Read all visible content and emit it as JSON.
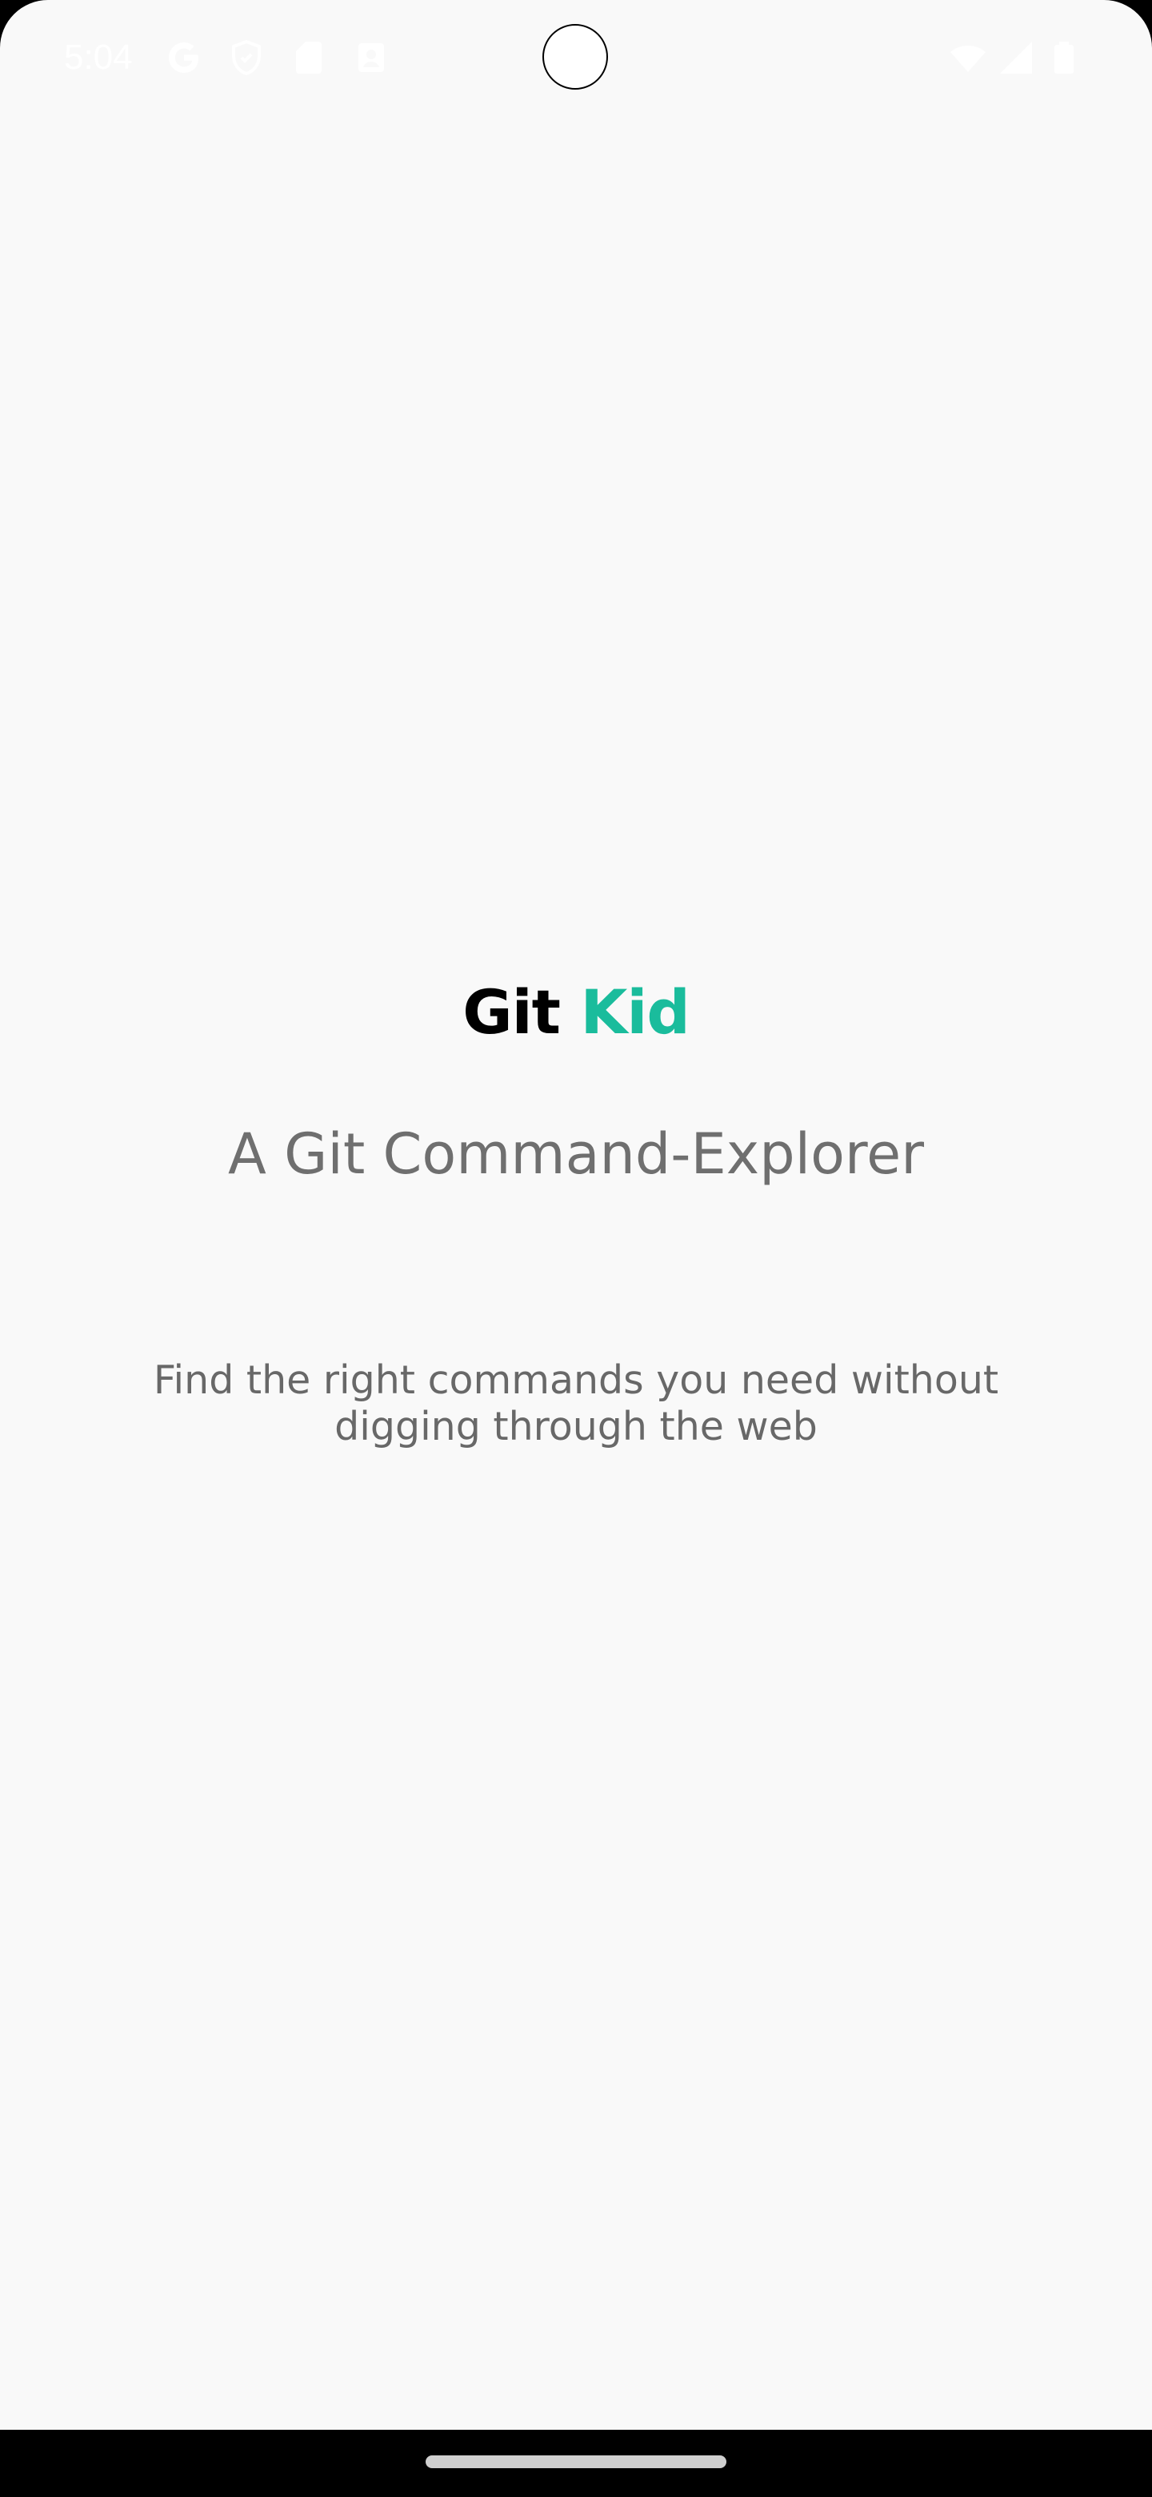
{
  "status_bar": {
    "time": "5:04",
    "icons": [
      "google-icon",
      "shield-icon",
      "sd-card-icon",
      "contact-card-icon",
      "wifi-icon",
      "cellular-signal-icon",
      "battery-icon"
    ]
  },
  "app": {
    "title_part1": "Git",
    "title_part2": "Kid",
    "title_accent_color": "#1abc9c",
    "subtitle": "A Git Command-Explorer",
    "description": "Find the right commands you need without digging through the web"
  }
}
